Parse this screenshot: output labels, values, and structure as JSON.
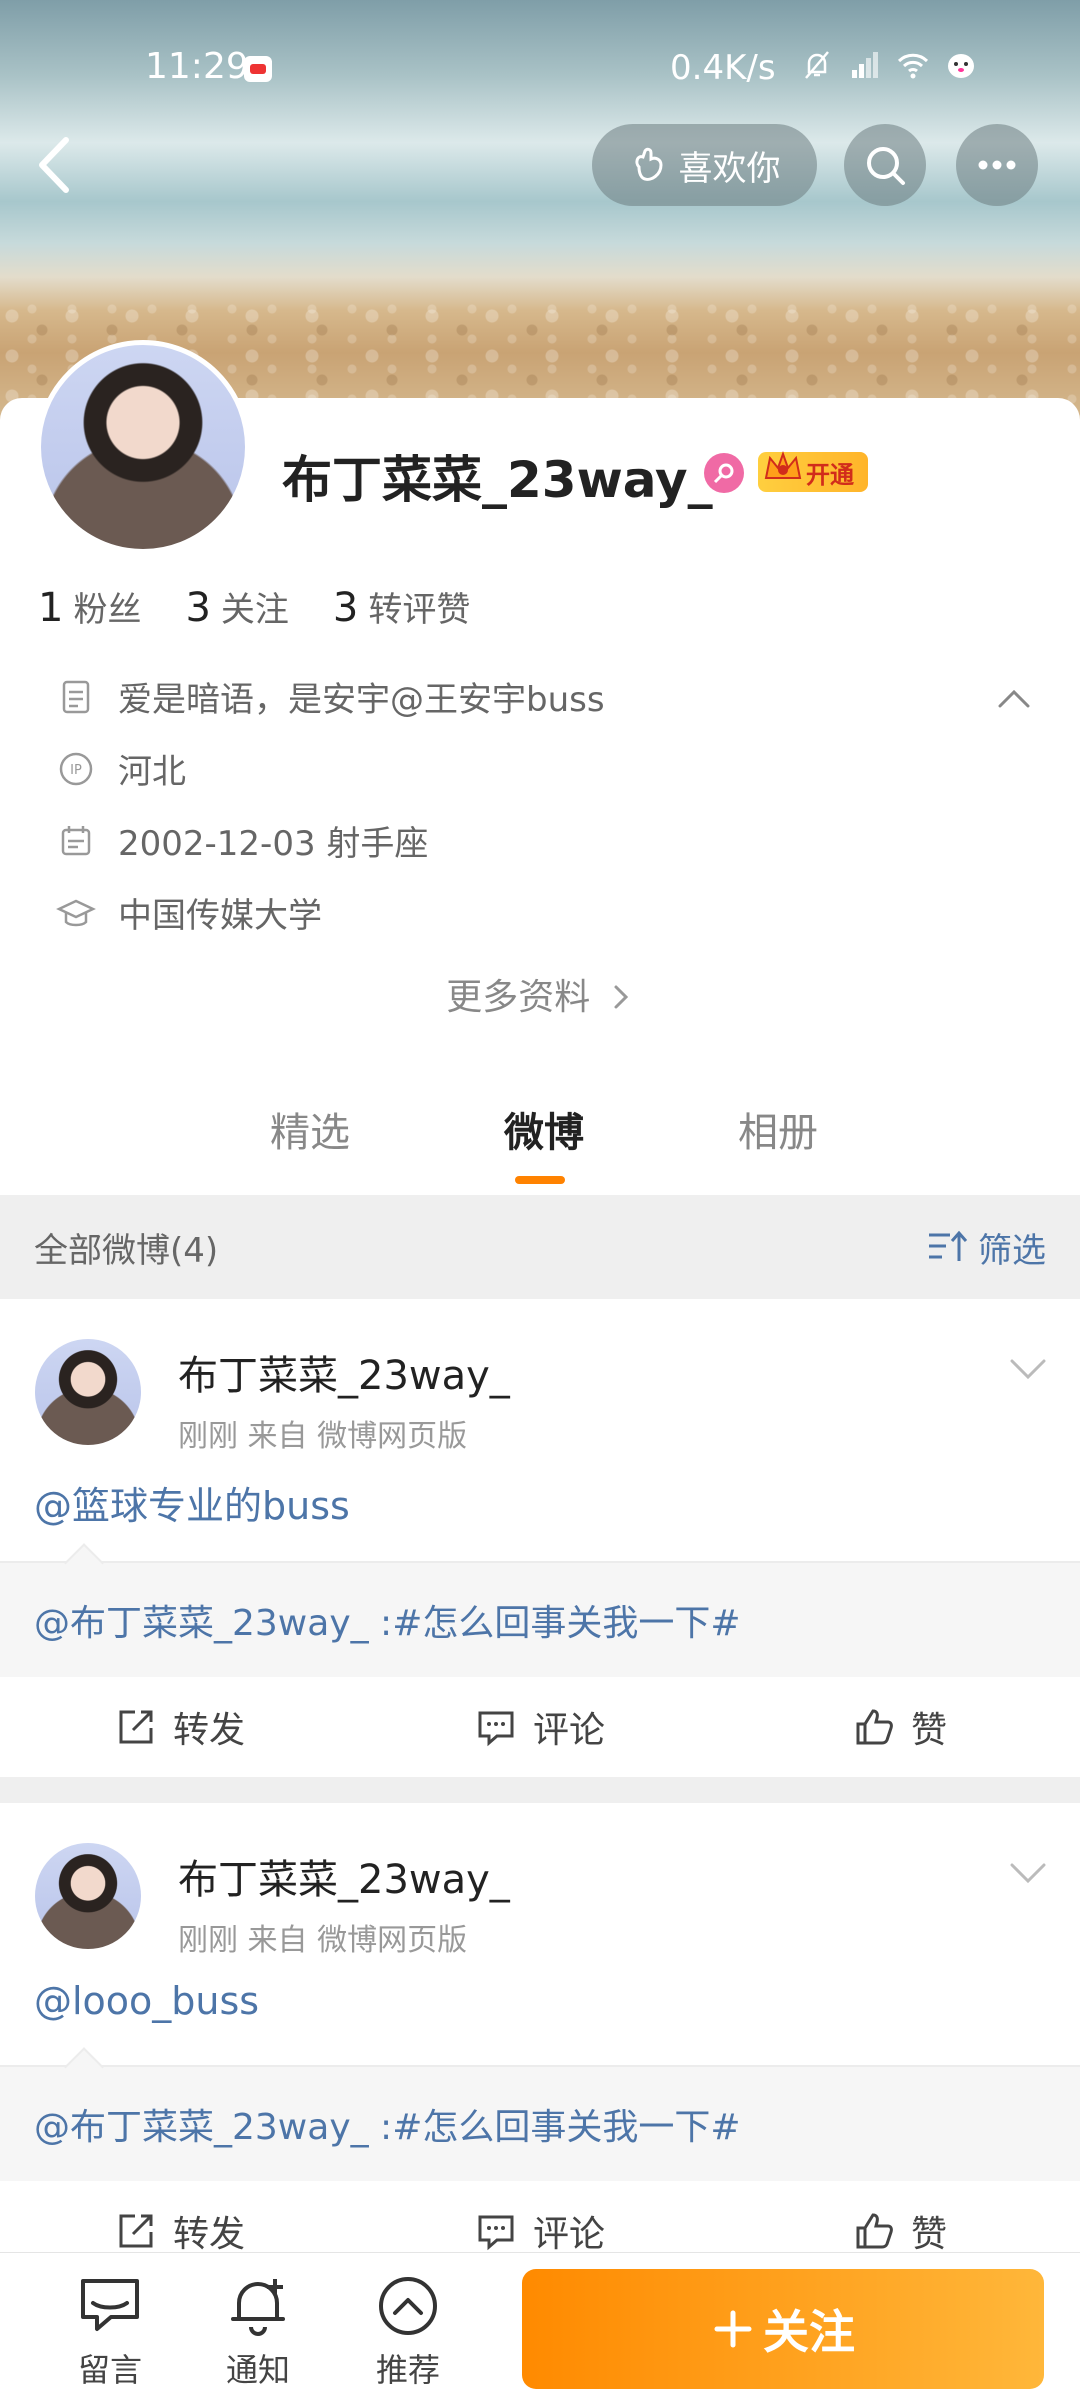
{
  "status_bar": {
    "time": "11:29",
    "speed": "0.4K/s"
  },
  "header": {
    "like_label": "喜欢你"
  },
  "profile": {
    "username": "布丁菜菜_23way_",
    "vip_label": "开通",
    "stats": [
      {
        "num": "1",
        "label": "粉丝"
      },
      {
        "num": "3",
        "label": "关注"
      },
      {
        "num": "3",
        "label": "转评赞"
      }
    ],
    "bio": "爱是暗语，是安宇@王安宇buss",
    "location": "河北",
    "birthday": "2002-12-03 射手座",
    "school": "中国传媒大学",
    "more_info": "更多资料"
  },
  "tabs": [
    "精选",
    "微博",
    "相册"
  ],
  "filter": {
    "left_label": "全部微博(4)",
    "right_label": "筛选"
  },
  "posts": [
    {
      "name": "布丁菜菜_23way_",
      "meta": "刚刚   来自 微博网页版",
      "text": "@篮球专业的buss",
      "repost": "@布丁菜菜_23way_ :#怎么回事关我一下#"
    },
    {
      "name": "布丁菜菜_23way_",
      "meta": "刚刚   来自 微博网页版",
      "text": "@looo_buss",
      "repost": "@布丁菜菜_23way_ :#怎么回事关我一下#"
    }
  ],
  "post_actions": {
    "repost": "转发",
    "comment": "评论",
    "like": "赞"
  },
  "bottom_bar": {
    "message": "留言",
    "notify": "通知",
    "recommend": "推荐",
    "follow": "关注"
  },
  "colors": {
    "accent": "#ff8200",
    "link": "#4d75a8"
  }
}
